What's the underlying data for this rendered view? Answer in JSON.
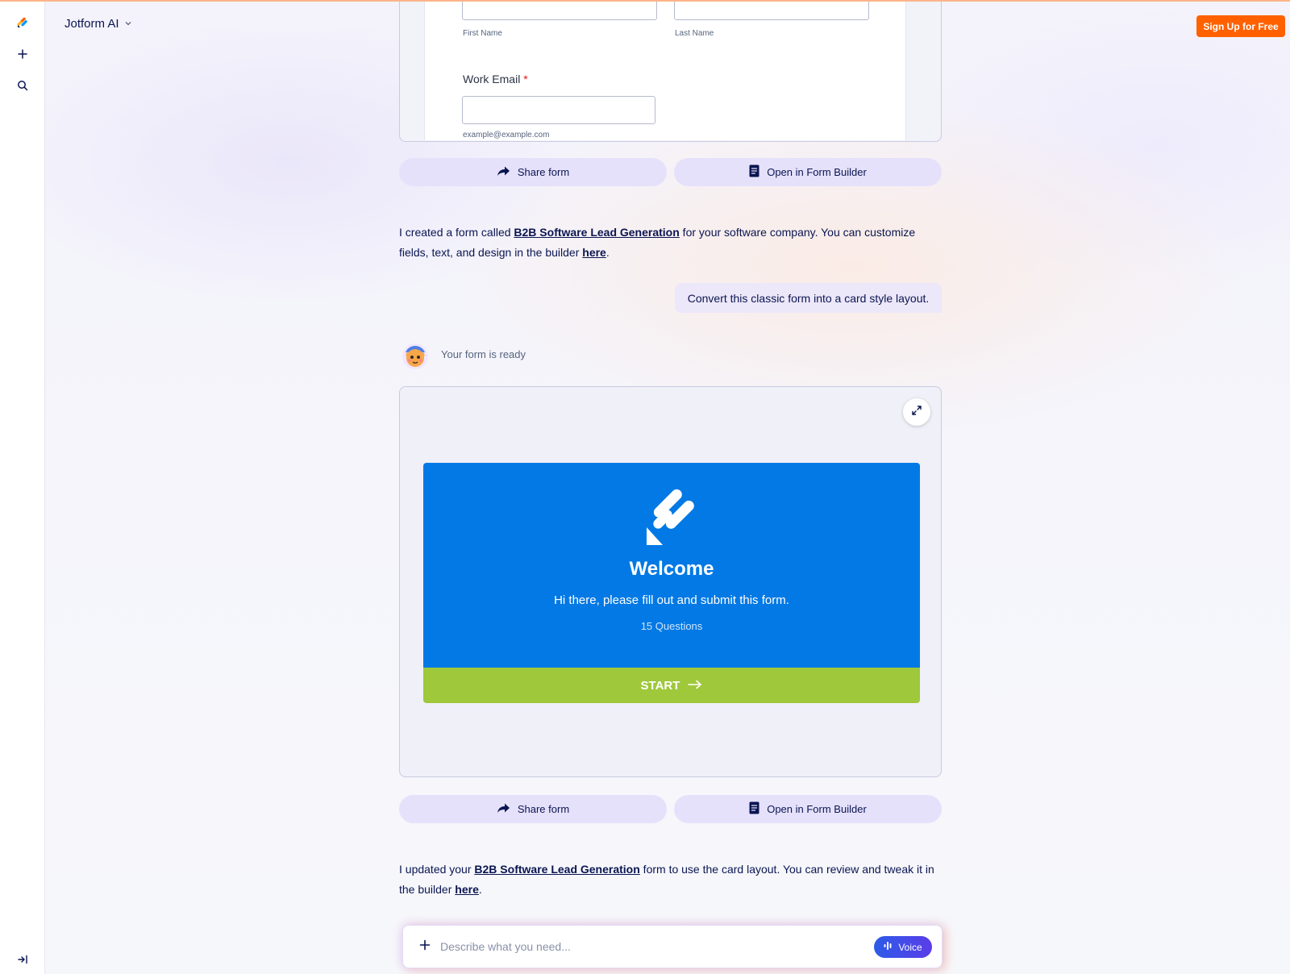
{
  "header": {
    "brand_label": "Jotform AI",
    "signup_label": "Sign Up for Free"
  },
  "rail": {
    "icons": [
      "jotform-logo-icon",
      "plus-icon",
      "search-icon",
      "collapse-sidebar-icon"
    ]
  },
  "classic_form": {
    "first_name_label": "First Name",
    "last_name_label": "Last Name",
    "work_email_label": "Work Email",
    "required_mark": "*",
    "email_hint": "example@example.com"
  },
  "actions_1": {
    "share_label": "Share form",
    "open_label": "Open in Form Builder"
  },
  "message_1": {
    "prefix": "I created a form called ",
    "form_link": "B2B Software Lead Generation",
    "middle": " for your software company. You can customize fields, text, and design in the builder ",
    "here_link": "here",
    "suffix": "."
  },
  "user_message": "Convert this classic form into a card style layout.",
  "assistant": {
    "status": "Your form is ready"
  },
  "card_form": {
    "title": "Welcome",
    "description": "Hi there, please fill out and submit this form.",
    "question_count": "15 Questions",
    "start_label": "START"
  },
  "actions_2": {
    "share_label": "Share form",
    "open_label": "Open in Form Builder"
  },
  "message_2": {
    "prefix": "I updated your ",
    "form_link": "B2B Software Lead Generation",
    "middle": " form to use the card layout. You can review and tweak it in the builder ",
    "here_link": "here",
    "suffix": "."
  },
  "composer": {
    "placeholder": "Describe what you need...",
    "voice_label": "Voice"
  },
  "colors": {
    "accent_orange": "#ff6100",
    "card_blue": "#0379e5",
    "start_green": "#9fc83b",
    "pill_lavender": "#e6e1fb",
    "navy_text": "#0a1551"
  }
}
